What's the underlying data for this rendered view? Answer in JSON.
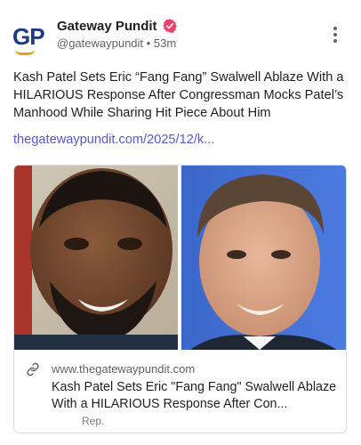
{
  "author": {
    "name": "Gateway Pundit",
    "handle": "@gatewaypundit",
    "separator": "•",
    "time": "53m",
    "avatar_text": "GP",
    "avatar_color": "#1e3b80",
    "avatar_accent": "#e6a319",
    "badge_icon": "verified-badge-icon",
    "badge_color": "#e8426e"
  },
  "post": {
    "text": "Kash Patel Sets Eric “Fang Fang” Swalwell Ablaze With a HILARIOUS Response After Congressman Mocks Patel’s Manhood While Sharing Hit Piece About Him",
    "link": "thegatewaypundit.com/2025/12/k...",
    "link_color": "#5a55d8"
  },
  "card": {
    "domain": "www.thegatewaypundit.com",
    "title": "Kash Patel Sets Eric \"Fang Fang\" Swalwell Ablaze With a HILARIOUS Response After Con...",
    "rep_label": "Rep.",
    "link_icon": "link-icon"
  },
  "menu": {
    "icon": "more-vertical-icon"
  }
}
